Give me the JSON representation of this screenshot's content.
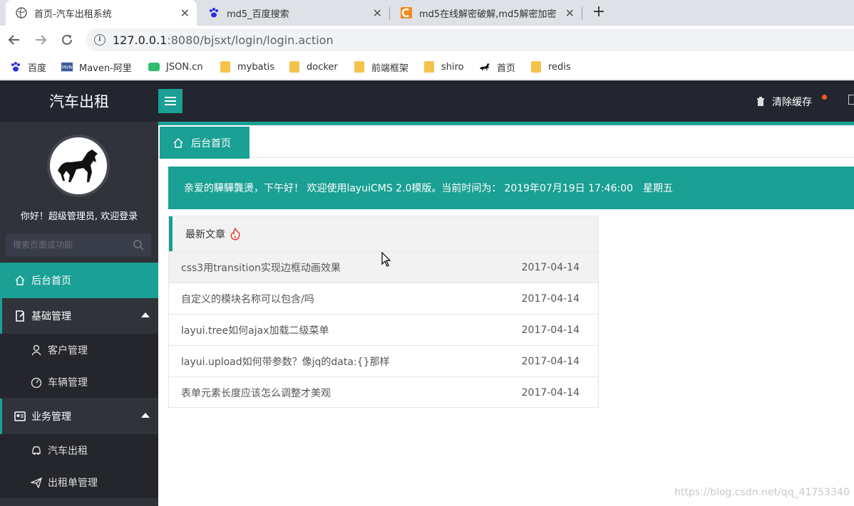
{
  "browser": {
    "tabs": [
      {
        "title": "首页-汽车出租系统",
        "close": "✕"
      },
      {
        "title": "md5_百度搜索",
        "close": "✕"
      },
      {
        "title": "md5在线解密破解,md5解密加密",
        "close": "✕"
      }
    ],
    "new_tab": "+",
    "url_host": "127.0.0.1",
    "url_path": ":8080/bjsxt/login/login.action",
    "bookmarks": [
      {
        "label": "百度",
        "icon": "baidu-paw-icon"
      },
      {
        "label": "Maven-阿里",
        "icon": "mvn-icon"
      },
      {
        "label": "JSON.cn",
        "icon": "json-icon"
      },
      {
        "label": "mybatis",
        "icon": "folder-icon"
      },
      {
        "label": "docker",
        "icon": "folder-icon"
      },
      {
        "label": "前端框架",
        "icon": "folder-icon"
      },
      {
        "label": "shiro",
        "icon": "folder-icon"
      },
      {
        "label": "首页",
        "icon": "horse-icon"
      },
      {
        "label": "redis",
        "icon": "folder-icon"
      }
    ]
  },
  "app": {
    "brand": "汽车出租",
    "clear_cache": "清除缓存",
    "greeting": "你好！超级管理员, 欢迎登录",
    "search_placeholder": "搜索页面或功能",
    "nav": {
      "home": "后台首页",
      "group1": "基础管理",
      "group1_items": [
        "客户管理",
        "车辆管理"
      ],
      "group2": "业务管理",
      "group2_items": [
        "汽车出租",
        "出租单管理"
      ]
    },
    "content_tab": "后台首页",
    "welcome": {
      "text": "亲爱的驊驊龔燙，下午好！ 欢迎使用layuiCMS 2.0模版。当前时间为：",
      "time": "2019年07月19日 17:46:00　星期五"
    },
    "articles_title": "最新文章",
    "articles": [
      {
        "title": "css3用transition实现边框动画效果",
        "date": "2017-04-14"
      },
      {
        "title": "自定义的模块名称可以包含/吗",
        "date": "2017-04-14"
      },
      {
        "title": "layui.tree如何ajax加载二级菜单",
        "date": "2017-04-14"
      },
      {
        "title": "layui.upload如何带参数？像jq的data:{}那样",
        "date": "2017-04-14"
      },
      {
        "title": "表单元素长度应该怎么调整才美观",
        "date": "2017-04-14"
      }
    ]
  },
  "watermark": "https://blog.csdn.net/qq_41753340",
  "colors": {
    "accent": "#1aa094",
    "header": "#23262e",
    "sidebar": "#30333a"
  }
}
